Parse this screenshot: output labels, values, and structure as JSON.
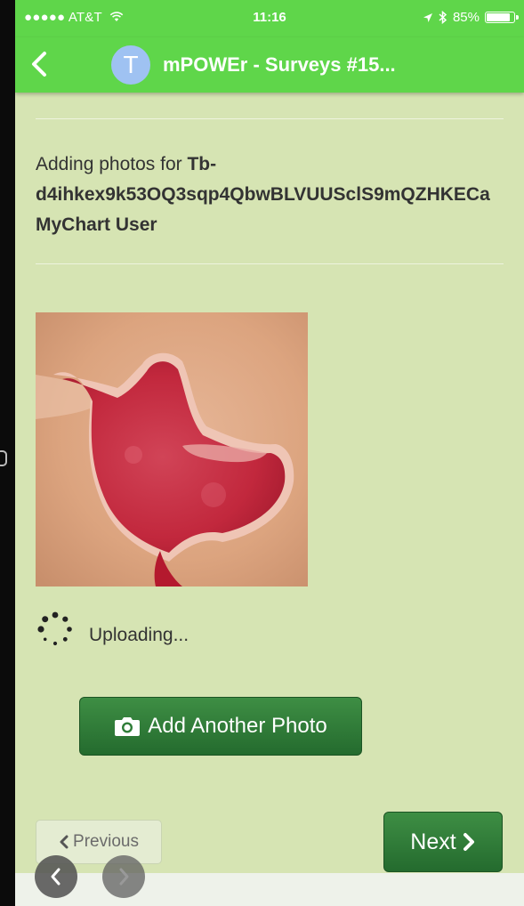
{
  "status_bar": {
    "carrier": "●●●●● AT&T",
    "time": "11:16",
    "battery": "85%",
    "battery_level": 0.85
  },
  "nav": {
    "avatar_letter": "T",
    "title": "mPOWEr - Surveys #15..."
  },
  "content": {
    "adding_prefix": "Adding photos for ",
    "id_line1": "Tb-",
    "id_line2": "d4ihkex9k53OQ3sqp4QbwBLVUUSclS9mQZHKECa",
    "user": "MyChart User",
    "uploading": "Uploading..."
  },
  "buttons": {
    "add_photo": "Add Another Photo",
    "previous": "Previous",
    "next": "Next"
  },
  "colors": {
    "header_green": "#5fd64a",
    "page_bg": "#d6e4b3",
    "button_green": "#2f7d38"
  },
  "icons": [
    "wifi-icon",
    "location-arrow-icon",
    "bluetooth-icon",
    "battery-icon",
    "back-chevron-icon",
    "camera-icon",
    "spinner-icon",
    "chevron-left-icon",
    "chevron-right-icon"
  ]
}
